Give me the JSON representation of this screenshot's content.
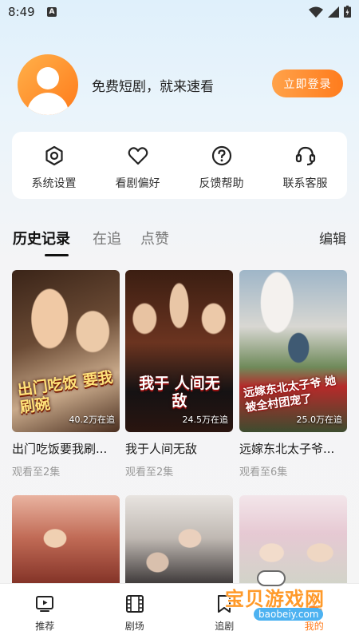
{
  "status_bar": {
    "time": "8:49",
    "notification_letter": "A"
  },
  "profile": {
    "slogan": "免费短剧，就来速看",
    "login_button": "立即登录"
  },
  "quick_actions": [
    {
      "label": "系统设置",
      "icon": "gear-icon"
    },
    {
      "label": "看剧偏好",
      "icon": "heart-icon"
    },
    {
      "label": "反馈帮助",
      "icon": "help-icon"
    },
    {
      "label": "联系客服",
      "icon": "headset-icon"
    }
  ],
  "tabs": {
    "items": [
      "历史记录",
      "在追",
      "点赞"
    ],
    "active_index": 0,
    "edit_label": "编辑"
  },
  "history": [
    {
      "title": "出门吃饭要我刷...",
      "poster_text": "出门吃饭 要我刷碗",
      "followers": "40.2万在追",
      "progress": "观看至2集"
    },
    {
      "title": "我于人间无敌",
      "poster_text": "我于 人间无敌",
      "followers": "24.5万在追",
      "progress": "观看至2集"
    },
    {
      "title": "远嫁东北太子爷...",
      "poster_text": "远嫁东北太子爷 她被全村团宠了",
      "followers": "25.0万在追",
      "progress": "观看至6集"
    }
  ],
  "bottom_nav": [
    {
      "label": "推荐",
      "icon": "play-icon"
    },
    {
      "label": "剧场",
      "icon": "film-icon"
    },
    {
      "label": "追剧",
      "icon": "bookmark-icon"
    },
    {
      "label": "我的",
      "icon": "user-icon"
    }
  ],
  "watermark": {
    "text": "宝贝游戏网",
    "url": "baobeiy.com"
  }
}
